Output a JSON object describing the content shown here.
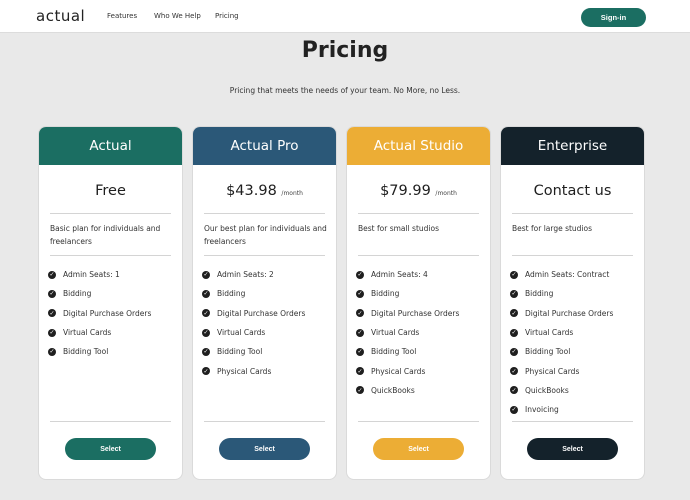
{
  "header": {
    "logo": "actual",
    "nav": [
      "Features",
      "Who We Help",
      "Pricing"
    ],
    "signin_label": "Sign-in",
    "signin_color": "#1b6e62"
  },
  "main": {
    "title": "Pricing",
    "subtitle": "Pricing that meets the needs of your team. No More, no Less."
  },
  "plans": [
    {
      "name": "Actual",
      "color": "#1b6e62",
      "price": "Free",
      "period": "",
      "description": "Basic plan for individuals and freelancers",
      "features": [
        "Admin Seats: 1",
        "Bidding",
        "Digital Purchase Orders",
        "Virtual Cards",
        "Bidding Tool"
      ],
      "button": "Select"
    },
    {
      "name": "Actual Pro",
      "color": "#2b5878",
      "price": "$43.98",
      "period": "/month",
      "description": "Our best plan for individuals and freelancers",
      "features": [
        "Admin Seats: 2",
        "Bidding",
        "Digital Purchase Orders",
        "Virtual Cards",
        "Bidding Tool",
        "Physical Cards"
      ],
      "button": "Select"
    },
    {
      "name": "Actual Studio",
      "color": "#ecad35",
      "price": "$79.99",
      "period": "/month",
      "description": "Best for small studios",
      "features": [
        "Admin Seats: 4",
        "Bidding",
        "Digital Purchase Orders",
        "Virtual Cards",
        "Bidding Tool",
        "Physical Cards",
        "QuickBooks"
      ],
      "button": "Select"
    },
    {
      "name": "Enterprise",
      "color": "#14222b",
      "price": "Contact us",
      "period": "",
      "description": "Best for large studios",
      "features": [
        "Admin Seats: Contract",
        "Bidding",
        "Digital Purchase Orders",
        "Virtual Cards",
        "Bidding Tool",
        "Physical Cards",
        "QuickBooks",
        "Invoicing"
      ],
      "button": "Select"
    }
  ]
}
